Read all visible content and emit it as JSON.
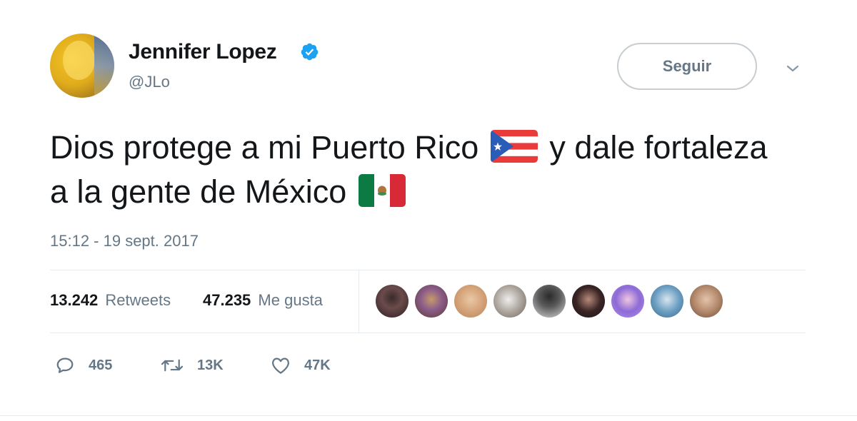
{
  "author": {
    "name": "Jennifer Lopez",
    "handle": "@JLo",
    "verified": true
  },
  "follow_label": "Seguir",
  "tweet": {
    "text_part1": "Dios protege a mi Puerto Rico",
    "flag1": "puerto-rico-flag",
    "text_part2": "y dale fortaleza a la gente de México",
    "flag2": "mexico-flag",
    "timestamp": "15:12 - 19 sept. 2017"
  },
  "stats": {
    "retweets_count": "13.242",
    "retweets_label": "Retweets",
    "likes_count": "47.235",
    "likes_label": "Me gusta"
  },
  "likers_shown": 9,
  "actions": {
    "replies": "465",
    "retweets": "13K",
    "likes": "47K"
  },
  "colors": {
    "text": "#14171a",
    "secondary": "#657786",
    "verified_blue": "#1da1f2",
    "divider": "#e6ecf0"
  }
}
